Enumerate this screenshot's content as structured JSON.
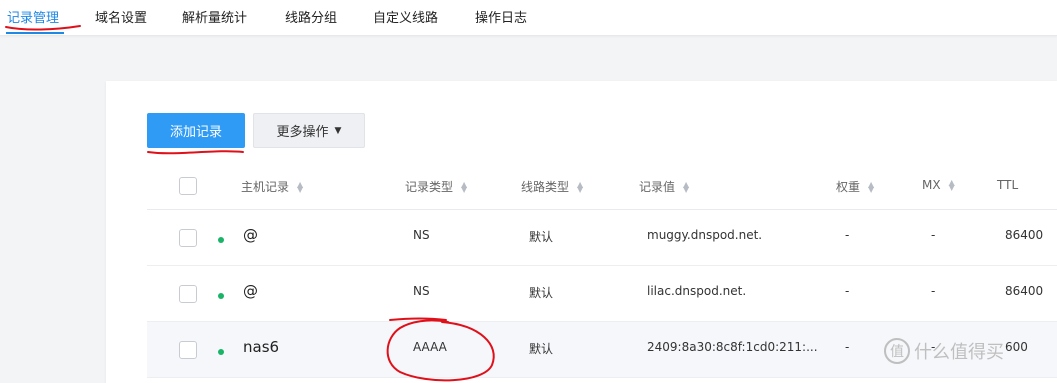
{
  "nav": {
    "tabs": [
      {
        "label": "记录管理",
        "active": true
      },
      {
        "label": "域名设置"
      },
      {
        "label": "解析量统计"
      },
      {
        "label": "线路分组"
      },
      {
        "label": "自定义线路"
      },
      {
        "label": "操作日志"
      }
    ]
  },
  "toolbar": {
    "add_label": "添加记录",
    "more_label": "更多操作",
    "more_caret": "▼"
  },
  "table": {
    "columns": [
      "主机记录",
      "记录类型",
      "线路类型",
      "记录值",
      "权重",
      "MX",
      "TTL"
    ],
    "rows": [
      {
        "status": "enabled",
        "host": "@",
        "type": "NS",
        "line": "默认",
        "value": "muggy.dnspod.net.",
        "weight": "-",
        "mx": "-",
        "ttl": "86400"
      },
      {
        "status": "enabled",
        "host": "@",
        "type": "NS",
        "line": "默认",
        "value": "lilac.dnspod.net.",
        "weight": "-",
        "mx": "-",
        "ttl": "86400"
      },
      {
        "status": "enabled",
        "host": "nas6",
        "type": "AAAA",
        "line": "默认",
        "value": "2409:8a30:8c8f:1cd0:211:...",
        "weight": "-",
        "mx": "-",
        "ttl": "600"
      }
    ]
  },
  "colors": {
    "accent": "#1e88e5",
    "primary_button": "#2f9bf5",
    "status_dot": "#19b468",
    "annotation": "#e0101a"
  },
  "watermark": {
    "icon": "zhi-watermark-icon",
    "glyph": "值",
    "text": "什么值得买"
  }
}
